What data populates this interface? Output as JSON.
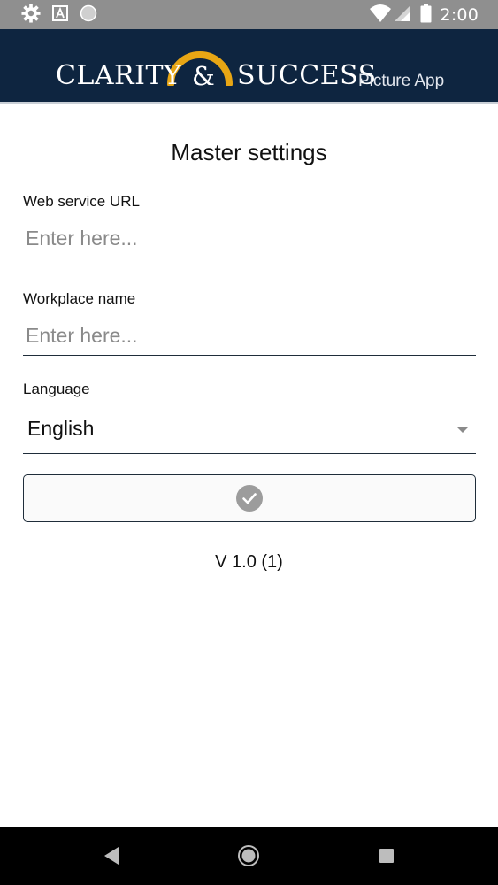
{
  "status_bar": {
    "time": "2:00",
    "left_icons": [
      "settings-icon",
      "font-icon",
      "circle-icon"
    ],
    "right_icons": [
      "wifi-icon",
      "signal-icon",
      "battery-icon"
    ]
  },
  "header": {
    "logo_word_1": "CLARITY",
    "logo_ampersand": "&",
    "logo_word_2": "SUCCESS",
    "logo_subtitle": "Picture App",
    "background_color": "#0e2540",
    "arc_color": "#e8a614"
  },
  "main": {
    "title": "Master settings",
    "web_service_url": {
      "label": "Web service URL",
      "value": "",
      "placeholder": "Enter here..."
    },
    "workplace_name": {
      "label": "Workplace name",
      "value": "",
      "placeholder": "Enter here..."
    },
    "language": {
      "label": "Language",
      "selected": "English"
    },
    "confirm_icon": "check-circle-icon",
    "version": "V 1.0 (1)"
  },
  "nav_bar": {
    "buttons": [
      "back-icon",
      "home-icon",
      "recents-icon"
    ]
  }
}
